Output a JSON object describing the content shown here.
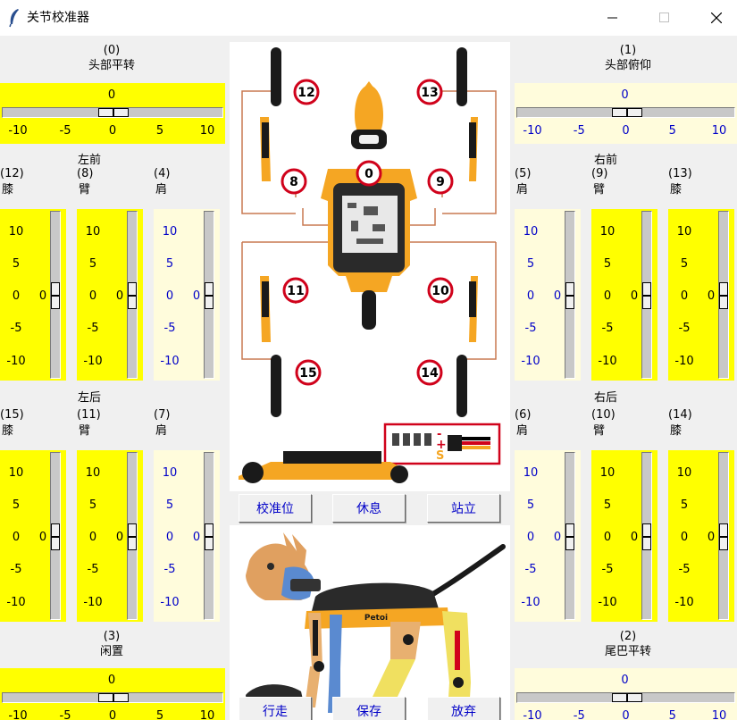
{
  "window": {
    "title": "关节校准器"
  },
  "colors": {
    "active_bg": "#ffff00",
    "inactive_bg": "#fffcdc",
    "active_tick": "#000000",
    "inactive_tick": "#0000c8",
    "button_text": "#0000c8",
    "dog_orange": "#f5a623",
    "servo_red": "#d0021b"
  },
  "hscales": [
    {
      "index": "(0)",
      "name": "头部平转",
      "value": "0",
      "value_num": 0,
      "active": true,
      "ticks": [
        "-10",
        "-5",
        "0",
        "5",
        "10"
      ]
    },
    {
      "index": "(1)",
      "name": "头部俯仰",
      "value": "0",
      "value_num": 0,
      "active": false,
      "ticks": [
        "-10",
        "-5",
        "0",
        "5",
        "10"
      ]
    },
    {
      "index": "(3)",
      "name": "闲置",
      "value": "0",
      "value_num": 0,
      "active": true,
      "ticks": [
        "-10",
        "-5",
        "0",
        "5",
        "10"
      ]
    },
    {
      "index": "(2)",
      "name": "尾巴平转",
      "value": "0",
      "value_num": 0,
      "active": false,
      "ticks": [
        "-10",
        "-5",
        "0",
        "5",
        "10"
      ]
    }
  ],
  "groups": {
    "front_left": "左前",
    "front_right": "右前",
    "back_left": "左后",
    "back_right": "右后"
  },
  "vscales": [
    {
      "index": "(12)",
      "name": "膝",
      "value": "0",
      "value_num": 0,
      "active": true,
      "ticks": [
        "10",
        "5",
        "0",
        "-5",
        "-10"
      ]
    },
    {
      "index": "(8)",
      "name": "臂",
      "value": "0",
      "value_num": 0,
      "active": true,
      "ticks": [
        "10",
        "5",
        "0",
        "-5",
        "-10"
      ]
    },
    {
      "index": "(4)",
      "name": "肩",
      "value": "0",
      "value_num": 0,
      "active": false,
      "ticks": [
        "10",
        "5",
        "0",
        "-5",
        "-10"
      ]
    },
    {
      "index": "(5)",
      "name": "肩",
      "value": "0",
      "value_num": 0,
      "active": false,
      "ticks": [
        "10",
        "5",
        "0",
        "-5",
        "-10"
      ]
    },
    {
      "index": "(9)",
      "name": "臂",
      "value": "0",
      "value_num": 0,
      "active": true,
      "ticks": [
        "10",
        "5",
        "0",
        "-5",
        "-10"
      ]
    },
    {
      "index": "(13)",
      "name": "膝",
      "value": "0",
      "value_num": 0,
      "active": true,
      "ticks": [
        "10",
        "5",
        "0",
        "-5",
        "-10"
      ]
    },
    {
      "index": "(15)",
      "name": "膝",
      "value": "0",
      "value_num": 0,
      "active": true,
      "ticks": [
        "10",
        "5",
        "0",
        "-5",
        "-10"
      ]
    },
    {
      "index": "(11)",
      "name": "臂",
      "value": "0",
      "value_num": 0,
      "active": true,
      "ticks": [
        "10",
        "5",
        "0",
        "-5",
        "-10"
      ]
    },
    {
      "index": "(7)",
      "name": "肩",
      "value": "0",
      "value_num": 0,
      "active": false,
      "ticks": [
        "10",
        "5",
        "0",
        "-5",
        "-10"
      ]
    },
    {
      "index": "(6)",
      "name": "肩",
      "value": "0",
      "value_num": 0,
      "active": false,
      "ticks": [
        "10",
        "5",
        "0",
        "-5",
        "-10"
      ]
    },
    {
      "index": "(10)",
      "name": "臂",
      "value": "0",
      "value_num": 0,
      "active": true,
      "ticks": [
        "10",
        "5",
        "0",
        "-5",
        "-10"
      ]
    },
    {
      "index": "(14)",
      "name": "膝",
      "value": "0",
      "value_num": 0,
      "active": true,
      "ticks": [
        "10",
        "5",
        "0",
        "-5",
        "-10"
      ]
    }
  ],
  "buttons": {
    "calibrate": "校准位",
    "rest": "休息",
    "stand": "站立",
    "walk": "行走",
    "save": "保存",
    "abort": "放弃"
  },
  "diagram": {
    "servo_numbers": [
      "0",
      "8",
      "9",
      "11",
      "10",
      "12",
      "13",
      "15",
      "14"
    ],
    "brand": "Petoi",
    "connector_plus": "+",
    "connector_minus": "-",
    "connector_signal": "S"
  }
}
